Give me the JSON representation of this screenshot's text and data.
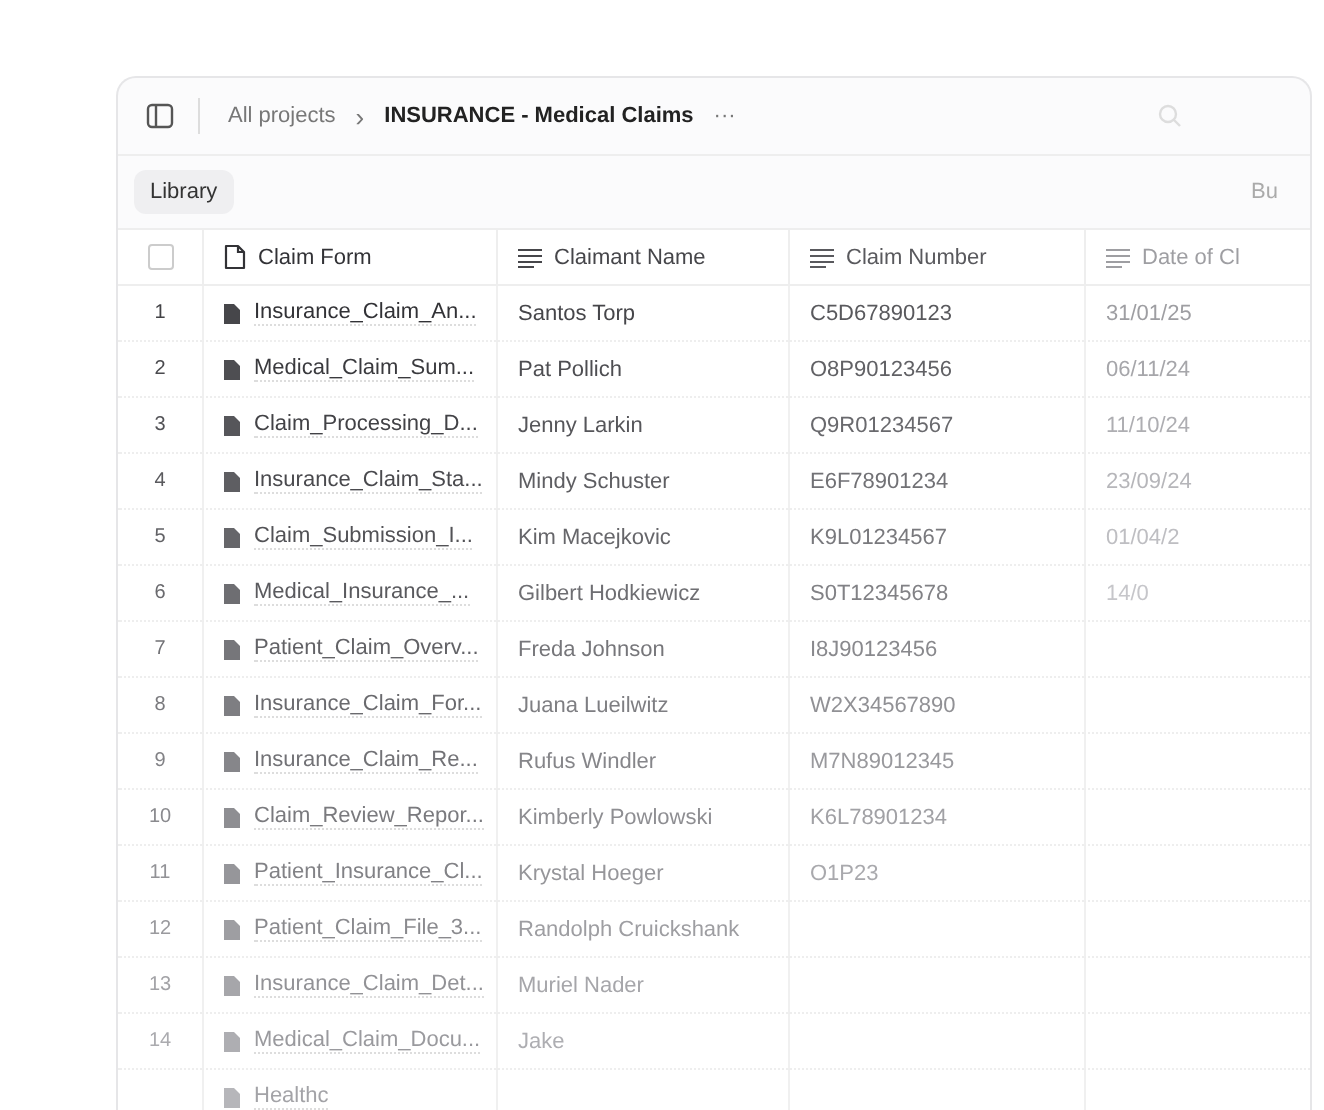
{
  "breadcrumb": {
    "parent": "All projects",
    "separator": "›",
    "current": "INSURANCE - Medical Claims",
    "more": "···"
  },
  "toolbar": {
    "library_button": "Library",
    "right_button": "Bu"
  },
  "table": {
    "select_all": {
      "checked": false
    },
    "columns": [
      {
        "label": "Claim Form",
        "kind": "file"
      },
      {
        "label": "Claimant Name",
        "kind": "text"
      },
      {
        "label": "Claim Number",
        "kind": "text"
      },
      {
        "label": "Date of Cl",
        "kind": "text"
      }
    ],
    "rows": [
      {
        "number": "1",
        "cells": [
          "Insurance_Claim_An...",
          "Santos Torp",
          "C5D67890123",
          "31/01/25"
        ]
      },
      {
        "number": "2",
        "cells": [
          "Medical_Claim_Sum...",
          "Pat Pollich",
          "O8P90123456",
          "06/11/24"
        ]
      },
      {
        "number": "3",
        "cells": [
          "Claim_Processing_D...",
          "Jenny Larkin",
          "Q9R01234567",
          "11/10/24"
        ]
      },
      {
        "number": "4",
        "cells": [
          "Insurance_Claim_Sta...",
          "Mindy Schuster",
          "E6F78901234",
          "23/09/24"
        ]
      },
      {
        "number": "5",
        "cells": [
          "Claim_Submission_I...",
          "Kim Macejkovic",
          "K9L01234567",
          "01/04/2"
        ]
      },
      {
        "number": "6",
        "cells": [
          "Medical_Insurance_...",
          "Gilbert Hodkiewicz",
          "S0T12345678",
          "14/0"
        ]
      },
      {
        "number": "7",
        "cells": [
          "Patient_Claim_Overv...",
          "Freda Johnson",
          "I8J90123456",
          ""
        ]
      },
      {
        "number": "8",
        "cells": [
          "Insurance_Claim_For...",
          "Juana Lueilwitz",
          "W2X34567890",
          ""
        ]
      },
      {
        "number": "9",
        "cells": [
          "Insurance_Claim_Re...",
          "Rufus Windler",
          "M7N89012345",
          ""
        ]
      },
      {
        "number": "10",
        "cells": [
          "Claim_Review_Repor...",
          "Kimberly Powlowski",
          "K6L78901234",
          ""
        ]
      },
      {
        "number": "11",
        "cells": [
          "Patient_Insurance_Cl...",
          "Krystal Hoeger",
          "O1P23",
          ""
        ]
      },
      {
        "number": "12",
        "cells": [
          "Patient_Claim_File_3...",
          "Randolph Cruickshank",
          "",
          ""
        ]
      },
      {
        "number": "13",
        "cells": [
          "Insurance_Claim_Det...",
          "Muriel Nader",
          "",
          ""
        ]
      },
      {
        "number": "14",
        "cells": [
          "Medical_Claim_Docu...",
          "Jake",
          "",
          ""
        ]
      },
      {
        "number": "",
        "cells": [
          "Healthc",
          "",
          "",
          ""
        ]
      }
    ]
  }
}
